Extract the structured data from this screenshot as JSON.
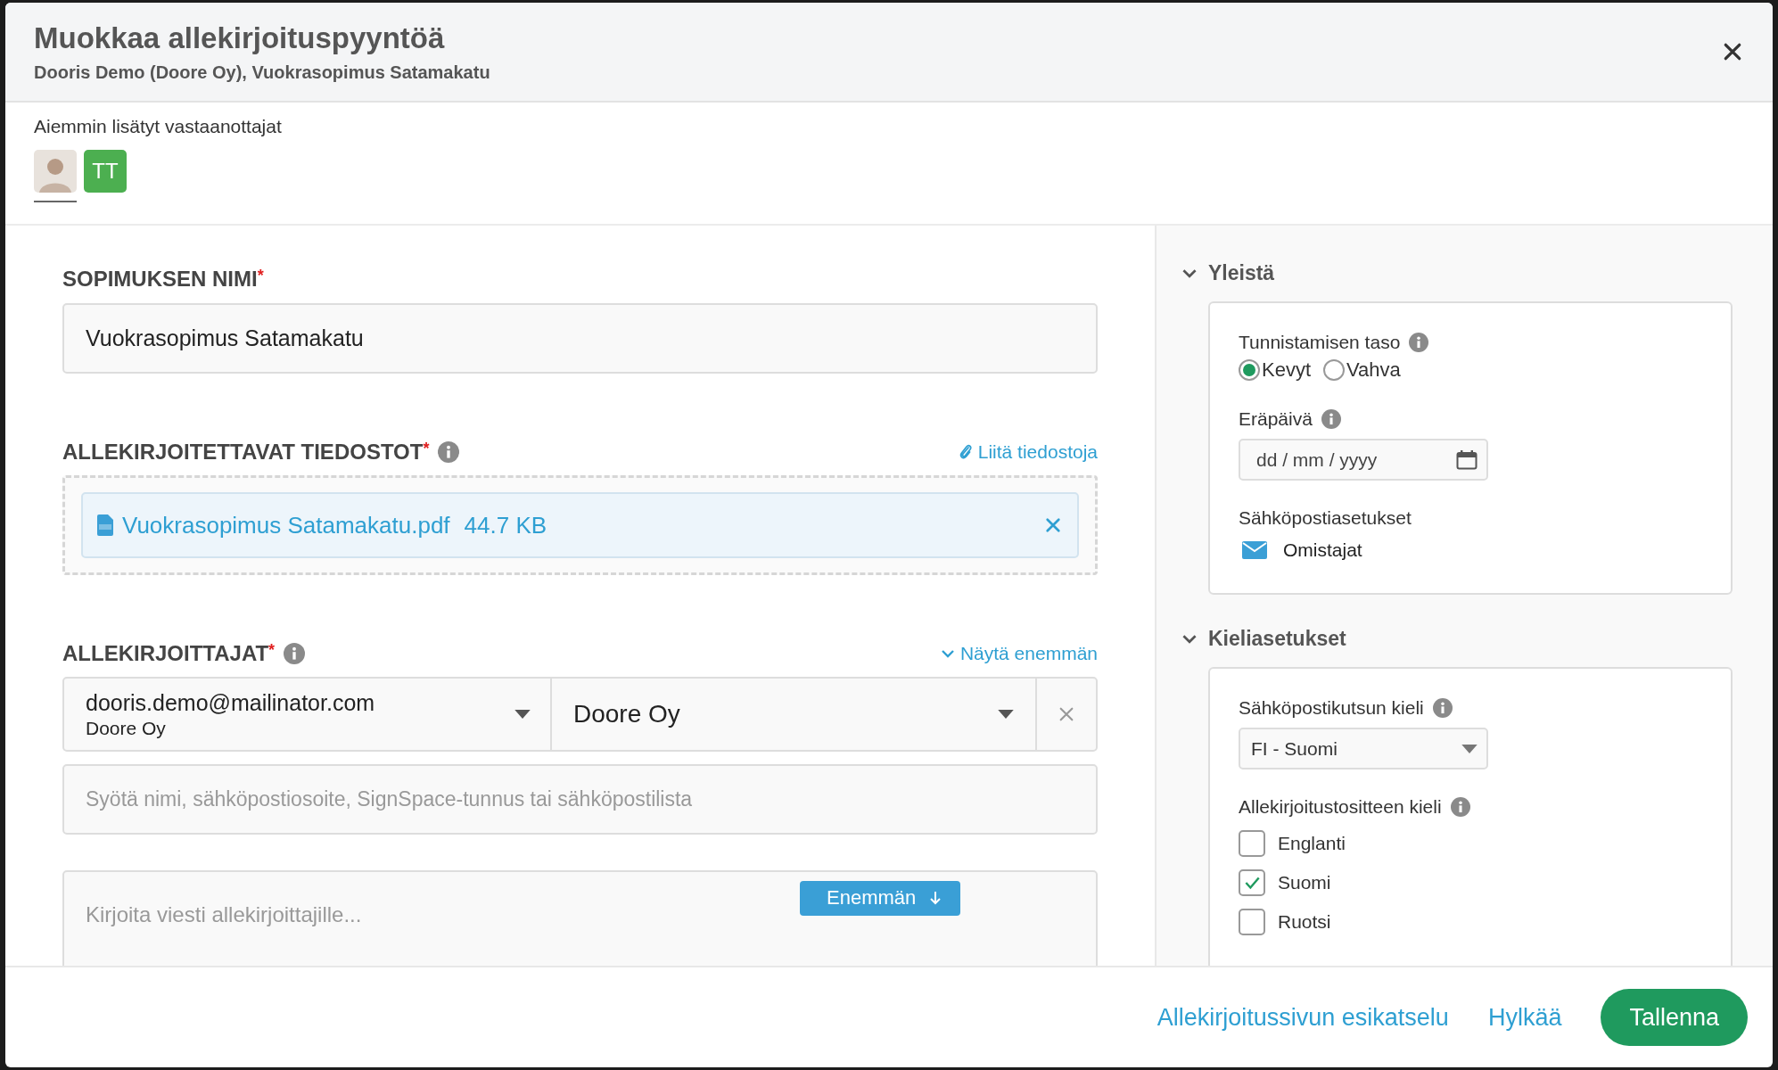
{
  "dialog": {
    "title": "Muokkaa allekirjoituspyyntöä",
    "subtitle": "Dooris Demo (Doore Oy), Vuokrasopimus Satamakatu"
  },
  "recipients": {
    "label": "Aiemmin lisätyt vastaanottajat",
    "items": [
      {
        "kind": "photo",
        "selected": true
      },
      {
        "kind": "initials",
        "initials": "TT",
        "selected": false
      }
    ]
  },
  "contract_name": {
    "label": "SOPIMUKSEN NIMI",
    "required_mark": "*",
    "value": "Vuokrasopimus Satamakatu"
  },
  "files": {
    "label": "ALLEKIRJOITETTAVAT TIEDOSTOT",
    "required_mark": "*",
    "attach_link": "Liitä tiedostoja",
    "items": [
      {
        "name": "Vuokrasopimus Satamakatu.pdf",
        "size": "44.7 KB"
      }
    ]
  },
  "signers": {
    "label": "ALLEKIRJOITTAJAT",
    "required_mark": "*",
    "show_more": "Näytä enemmän",
    "rows": [
      {
        "email": "dooris.demo@mailinator.com",
        "organization": "Doore Oy",
        "company": "Doore Oy"
      }
    ],
    "search_placeholder": "Syötä nimi, sähköpostiosoite, SignSpace-tunnus tai sähköpostilista",
    "message_placeholder": "Kirjoita viesti allekirjoittajille...",
    "more_button": "Enemmän"
  },
  "general": {
    "title": "Yleistä",
    "expanded": true,
    "auth_label": "Tunnistamisen taso",
    "auth_options": [
      {
        "label": "Kevyt",
        "selected": true
      },
      {
        "label": "Vahva",
        "selected": false
      }
    ],
    "due_label": "Eräpäivä",
    "due_placeholder": "dd / mm / yyyy",
    "email_label": "Sähköpostiasetukset",
    "email_option": "Omistajat"
  },
  "language": {
    "title": "Kieliasetukset",
    "expanded": true,
    "invite_label": "Sähköpostikutsun kieli",
    "invite_value": "FI - Suomi",
    "doc_label": "Allekirjoitustositteen kieli",
    "doc_languages": [
      {
        "label": "Englanti",
        "checked": false
      },
      {
        "label": "Suomi",
        "checked": true
      },
      {
        "label": "Ruotsi",
        "checked": false
      }
    ]
  },
  "footer": {
    "preview_link": "Allekirjoitussivun esikatselu",
    "reject": "Hylkää",
    "save": "Tallenna"
  }
}
